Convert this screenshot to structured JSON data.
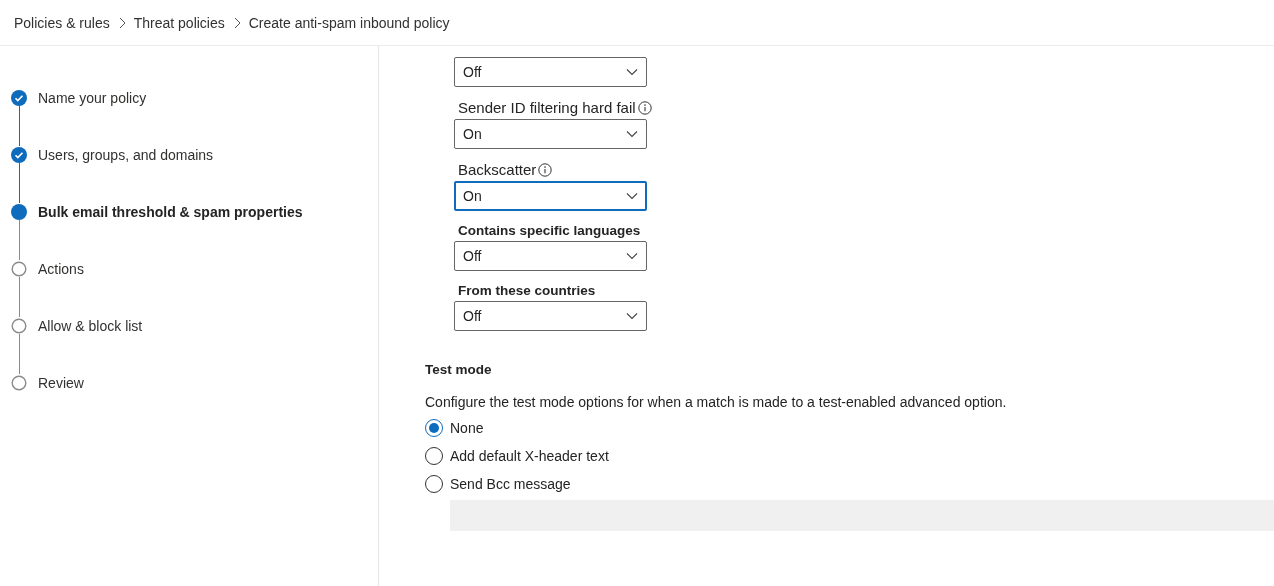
{
  "breadcrumb": [
    "Policies & rules",
    "Threat policies",
    "Create anti-spam inbound policy"
  ],
  "steps": [
    {
      "label": "Name your policy",
      "completed": true,
      "current": false
    },
    {
      "label": "Users, groups, and domains",
      "completed": true,
      "current": false
    },
    {
      "label": "Bulk email threshold & spam properties",
      "completed": false,
      "current": true
    },
    {
      "label": "Actions",
      "completed": false,
      "current": false
    },
    {
      "label": "Allow & block list",
      "completed": false,
      "current": false
    },
    {
      "label": "Review",
      "completed": false,
      "current": false
    }
  ],
  "settings": [
    {
      "value": "Off",
      "focused": false
    },
    {
      "label": "Sender ID filtering hard fail",
      "info": true,
      "bold": false,
      "value": "On",
      "focused": false
    },
    {
      "label": "Backscatter",
      "info": true,
      "bold": false,
      "value": "On",
      "focused": true
    },
    {
      "label": "Contains specific languages",
      "info": false,
      "bold": true,
      "value": "Off",
      "focused": false
    },
    {
      "label": "From these countries",
      "info": false,
      "bold": true,
      "value": "Off",
      "focused": false
    }
  ],
  "test_mode": {
    "title": "Test mode",
    "description": "Configure the test mode options for when a match is made to a test-enabled advanced option.",
    "options": [
      {
        "label": "None",
        "selected": true
      },
      {
        "label": "Add default X-header text",
        "selected": false
      },
      {
        "label": "Send Bcc message",
        "selected": false
      }
    ],
    "bcc_field": {
      "disabled": true
    }
  }
}
